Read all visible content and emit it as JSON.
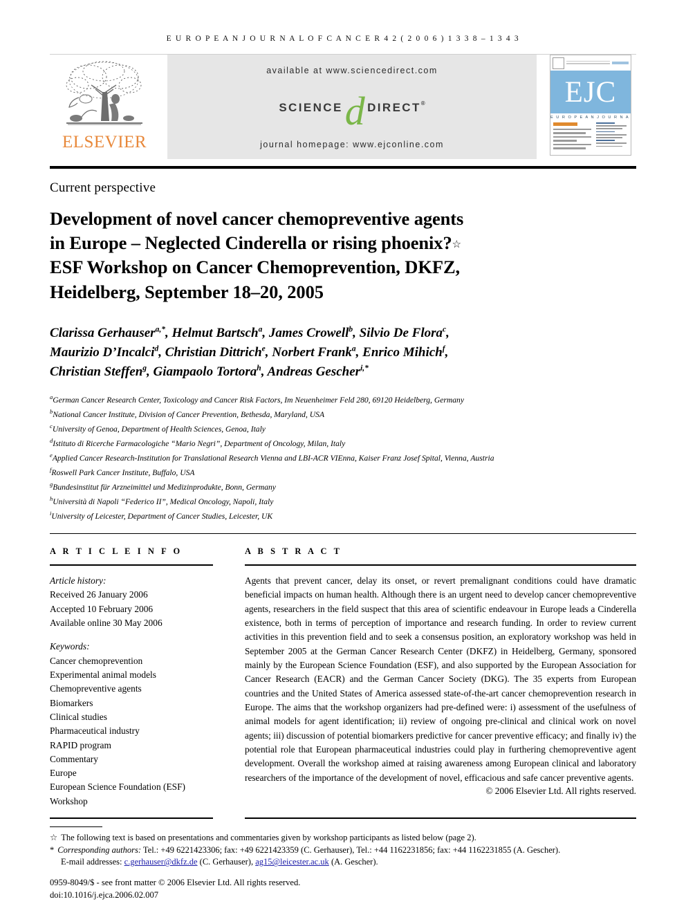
{
  "running_head": "E U R O P E A N   J O U R N A L   O F   C A N C E R   4 2   ( 2 0 0 6 )   1 3 3 8 – 1 3 4 3",
  "masthead": {
    "publisher": "ELSEVIER",
    "available_at": "available at www.sciencedirect.com",
    "sciencedirect_left": "SCIENCE",
    "sciencedirect_d": "d",
    "sciencedirect_right": "DIRECT",
    "registered_mark": "®",
    "journal_homepage": "journal homepage: www.ejconline.com",
    "cover_logo": "EJC",
    "cover_subtitle": "E U R O P E A N   J O U R N A L   O F   C A N C E R"
  },
  "colors": {
    "elsevier_orange": "#E8883A",
    "sciencedirect_green": "#7AB648",
    "cover_blue": "#7FB6DD",
    "link_blue": "#1A1AA8",
    "band_gray": "#E6E6E6"
  },
  "article": {
    "section_type": "Current perspective",
    "title_line_1": "Development of novel cancer chemopreventive agents",
    "title_line_2": "in Europe – Neglected Cinderella or rising phoenix?",
    "title_marker": "☆",
    "title_line_3": "ESF Workshop on Cancer Chemoprevention, DKFZ,",
    "title_line_4": "Heidelberg, September 18–20, 2005"
  },
  "authors": [
    {
      "name": "Clarissa Gerhauser",
      "sup": "a,*"
    },
    {
      "name": "Helmut Bartsch",
      "sup": "a"
    },
    {
      "name": "James Crowell",
      "sup": "b"
    },
    {
      "name": "Silvio De Flora",
      "sup": "c"
    },
    {
      "name": "Maurizio D’Incalci",
      "sup": "d"
    },
    {
      "name": "Christian Dittrich",
      "sup": "e"
    },
    {
      "name": "Norbert Frank",
      "sup": "a"
    },
    {
      "name": "Enrico Mihich",
      "sup": "f"
    },
    {
      "name": "Christian Steffen",
      "sup": "g"
    },
    {
      "name": "Giampaolo Tortora",
      "sup": "h"
    },
    {
      "name": "Andreas Gescher",
      "sup": "i,*"
    }
  ],
  "affiliations": [
    {
      "mark": "a",
      "text": "German Cancer Research Center, Toxicology and Cancer Risk Factors, Im Neuenheimer Feld 280, 69120 Heidelberg, Germany"
    },
    {
      "mark": "b",
      "text": "National Cancer Institute, Division of Cancer Prevention, Bethesda, Maryland, USA"
    },
    {
      "mark": "c",
      "text": "University of Genoa, Department of Health Sciences, Genoa, Italy"
    },
    {
      "mark": "d",
      "text": "Istituto di Ricerche Farmacologiche “Mario Negri”, Department of Oncology, Milan, Italy"
    },
    {
      "mark": "e",
      "text": "Applied Cancer Research-Institution for Translational Research Vienna and LBI-ACR VIEnna, Kaiser Franz Josef Spital, Vienna, Austria"
    },
    {
      "mark": "f",
      "text": "Roswell Park Cancer Institute, Buffalo, USA"
    },
    {
      "mark": "g",
      "text": "Bundesinstitut für Arzneimittel und Medizinprodukte, Bonn, Germany"
    },
    {
      "mark": "h",
      "text": "Università di Napoli “Federico II”, Medical Oncology, Napoli, Italy"
    },
    {
      "mark": "i",
      "text": "University of Leicester, Department of Cancer Studies, Leicester, UK"
    }
  ],
  "article_info": {
    "heading": "A R T I C L E   I N F O",
    "history_label": "Article history:",
    "received": "Received 26 January 2006",
    "accepted": "Accepted 10 February 2006",
    "available_online": "Available online 30 May 2006",
    "keywords_label": "Keywords:",
    "keywords": [
      "Cancer chemoprevention",
      "Experimental animal models",
      "Chemopreventive agents",
      "Biomarkers",
      "Clinical studies",
      "Pharmaceutical industry",
      "RAPID program",
      "Commentary",
      "Europe",
      "European Science Foundation (ESF)",
      "Workshop"
    ]
  },
  "abstract": {
    "heading": "A B S T R A C T",
    "text": "Agents that prevent cancer, delay its onset, or revert premalignant conditions could have dramatic beneficial impacts on human health. Although there is an urgent need to develop cancer chemopreventive agents, researchers in the field suspect that this area of scientific endeavour in Europe leads a Cinderella existence, both in terms of perception of importance and research funding. In order to review current activities in this prevention field and to seek a consensus position, an exploratory workshop was held in September 2005 at the German Cancer Research Center (DKFZ) in Heidelberg, Germany, sponsored mainly by the European Science Foundation (ESF), and also supported by the European Association for Cancer Research (EACR) and the German Cancer Society (DKG). The 35 experts from European countries and the United States of America assessed state-of-the-art cancer chemoprevention research in Europe. The aims that the workshop organizers had pre-defined were: i) assessment of the usefulness of animal models for agent identification; ii) review of ongoing pre-clinical and clinical work on novel agents; iii) discussion of potential biomarkers predictive for cancer preventive efficacy; and finally iv) the potential role that European pharmaceutical industries could play in furthering chemopreventive agent development. Overall the workshop aimed at raising awareness among European clinical and laboratory researchers of the importance of the development of novel, efficacious and safe cancer preventive agents.",
    "copyright": "© 2006 Elsevier Ltd. All rights reserved."
  },
  "footnotes": {
    "star_marker": "☆",
    "star_text": "The following text is based on presentations and commentaries given by workshop participants as listed below (page 2).",
    "corr_marker": "*",
    "corr_label": "Corresponding authors:",
    "corr_text": "Tel.: +49 6221423306; fax: +49 6221423359 (C. Gerhauser), Tel.: +44 1162231856; fax: +44 1162231855 (A. Gescher).",
    "email_label": "E-mail addresses:",
    "email_1": "c.gerhauser@dkfz.de",
    "email_1_owner": "(C. Gerhauser),",
    "email_2": "ag15@leicester.ac.uk",
    "email_2_owner": "(A. Gescher)."
  },
  "imprint": {
    "issn_line": "0959-8049/$ - see front matter © 2006 Elsevier Ltd. All rights reserved.",
    "doi_line": "doi:10.1016/j.ejca.2006.02.007"
  }
}
